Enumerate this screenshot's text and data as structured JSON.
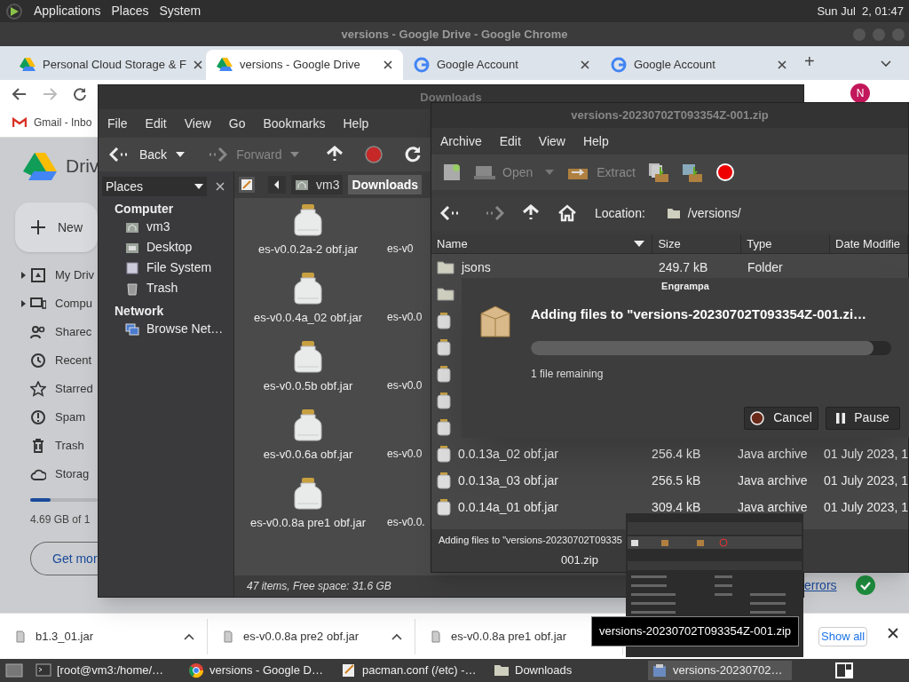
{
  "top_panel": {
    "menus": [
      "Applications",
      "Places",
      "System"
    ],
    "clock": "Sun Jul  2, 01:47"
  },
  "chrome": {
    "title": "versions - Google Drive - Google Chrome",
    "tabs": [
      {
        "label": "Personal Cloud Storage & F",
        "kind": "drive",
        "selected": false
      },
      {
        "label": "versions - Google Drive",
        "kind": "drive",
        "selected": true
      },
      {
        "label": "Google Account",
        "kind": "google",
        "selected": false
      },
      {
        "label": "Google Account",
        "kind": "google",
        "selected": false
      }
    ],
    "new_tab": "+",
    "profile": "N",
    "bookmark": "Gmail - Inbo",
    "drive": {
      "brand": "Driv",
      "new_button": "New",
      "nav": [
        {
          "label": "My Driv",
          "kind": "drive",
          "expandable": true
        },
        {
          "label": "Compu",
          "kind": "computer",
          "expandable": true
        },
        {
          "label": "Sharec",
          "kind": "people",
          "expandable": false
        },
        {
          "label": "Recent",
          "kind": "clock",
          "expandable": false
        },
        {
          "label": "Starred",
          "kind": "star",
          "expandable": false
        },
        {
          "label": "Spam",
          "kind": "alert",
          "expandable": false
        },
        {
          "label": "Trash",
          "kind": "trash",
          "expandable": false
        },
        {
          "label": "Storag",
          "kind": "cloud",
          "expandable": false
        }
      ],
      "storage": {
        "level": 0.3,
        "text": "4.69 GB of 1"
      },
      "get_more": "Get mor",
      "errors_link": "errors"
    },
    "downloads": [
      {
        "name": "b1.3_01.jar"
      },
      {
        "name": "es-v0.0.8a pre2 obf.jar"
      },
      {
        "name": "es-v0.0.8a pre1 obf.jar"
      }
    ],
    "show_all": "Show all"
  },
  "file_manager": {
    "title": "Downloads",
    "menus": [
      "File",
      "Edit",
      "View",
      "Go",
      "Bookmarks",
      "Help"
    ],
    "toolbar": [
      {
        "label": "Back",
        "kind": "back",
        "disabled": false
      },
      {
        "label": "Forward",
        "kind": "forward",
        "disabled": true
      }
    ],
    "side_pane": {
      "title": "Places",
      "sections": [
        {
          "title": "Computer",
          "items": [
            {
              "label": "vm3",
              "kind": "home"
            },
            {
              "label": "Desktop",
              "kind": "desktop"
            },
            {
              "label": "File System",
              "kind": "drive"
            },
            {
              "label": "Trash",
              "kind": "trash"
            }
          ]
        },
        {
          "title": "Network",
          "items": [
            {
              "label": "Browse Net…",
              "kind": "network"
            }
          ]
        }
      ]
    },
    "path": [
      {
        "label": "vm3",
        "selected": false
      },
      {
        "label": "Downloads",
        "selected": true
      }
    ],
    "files": [
      "es-v0.0.2a-2 obf.jar",
      "es-v0.0.4a_02 obf.jar",
      "es-v0.0.5b obf.jar",
      "es-v0.0.6a obf.jar",
      "es-v0.0.8a pre1 obf.jar"
    ],
    "column_2": [
      "es-v0",
      "es-v0.0",
      "es-v0.0",
      "es-v0.0",
      "es-v0.0."
    ],
    "status": "47 items, Free space: 31.6 GB"
  },
  "archive_manager": {
    "title": "versions-20230702T093354Z-001.zip",
    "menus": [
      "Archive",
      "Edit",
      "View",
      "Help"
    ],
    "toolbar": [
      {
        "label": "Open",
        "disabled": true
      },
      {
        "label": "Extract",
        "disabled": true
      }
    ],
    "location_label": "Location:",
    "location": "/versions/",
    "columns": [
      "Name",
      "Size",
      "Type",
      "Date Modifie"
    ],
    "rows": [
      {
        "kind": "folder",
        "name": "jsons",
        "size": "249.7 kB",
        "type": "Folder"
      },
      {
        "kind": "folder"
      },
      {
        "kind": "jar"
      },
      {
        "kind": "jar"
      },
      {
        "kind": "jar"
      },
      {
        "kind": "jar"
      },
      {
        "kind": "jar"
      },
      {
        "kind": "jar",
        "name": "0.0.13a_02 obf.jar",
        "size": "256.4 kB",
        "type": "Java archive",
        "date": "01 July 2023, 1"
      },
      {
        "kind": "jar",
        "name": "0.0.13a_03 obf.jar",
        "size": "256.5 kB",
        "type": "Java archive",
        "date": "01 July 2023, 1"
      },
      {
        "kind": "jar",
        "name": "0.0.14a_01 obf.jar",
        "size": "309.4 kB",
        "type": "Java archive",
        "date": "01 July 2023, 1"
      }
    ],
    "status": [
      "Adding files to \"versions-20230702T09335",
      "001.zip"
    ]
  },
  "progress_dialog": {
    "title": "Engrampa",
    "heading": "Adding files to \"versions-20230702T093354Z-001.zi…",
    "level": 0.95,
    "remaining": "1 file remaining",
    "buttons": [
      {
        "label": "Cancel",
        "kind": "stop"
      },
      {
        "label": "Pause",
        "kind": "pause"
      }
    ]
  },
  "tooltip": "versions-20230702T093354Z-001.zip",
  "taskbar": [
    {
      "label": "[root@vm3:/home/…",
      "kind": "terminal",
      "selected": false
    },
    {
      "label": "versions - Google D…",
      "kind": "browser",
      "selected": false
    },
    {
      "label": "pacman.conf (/etc) -…",
      "kind": "editor",
      "selected": false
    },
    {
      "label": "Downloads",
      "kind": "folder",
      "selected": false
    },
    {
      "label": "versions-20230702…",
      "kind": "archive",
      "selected": true
    }
  ]
}
